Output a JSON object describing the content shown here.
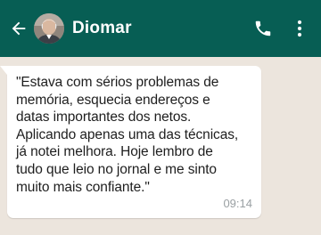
{
  "header": {
    "contact_name": "Diomar",
    "back_icon": "arrow-left-icon",
    "call_icon": "phone-icon",
    "menu_icon": "more-vertical-icon"
  },
  "message": {
    "text": "\"Estava com sérios problemas de\nmemória, esquecia endereços e\ndatas importantes dos netos.\nAplicando apenas uma das técnicas,\njá notei melhora. Hoje lembro de\ntudo que leio no jornal e me sinto\nmuito mais confiante.\"",
    "time": "09:14"
  },
  "colors": {
    "header_bg": "#075e54",
    "chat_bg": "#ece5dd",
    "bubble_bg": "#ffffff"
  }
}
